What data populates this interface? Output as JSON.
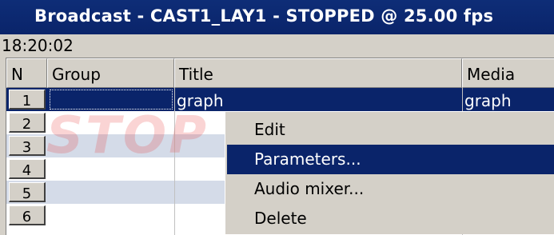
{
  "window": {
    "title": "Broadcast - CAST1_LAY1 - STOPPED @ 25.00 fps",
    "clock": "18:20:02"
  },
  "colors": {
    "titlebar": "#0a246a",
    "selection": "#0a246a",
    "alt_row": "#d4dbe8",
    "watermark": "#e83c3c"
  },
  "grid": {
    "columns": [
      "N",
      "Group",
      "Title",
      "Media"
    ],
    "rows": [
      {
        "n": "1",
        "group": "",
        "title": "graph",
        "media": "graph",
        "selected": true
      },
      {
        "n": "2",
        "group": "",
        "title": "",
        "media": "",
        "selected": false
      },
      {
        "n": "3",
        "group": "",
        "title": "",
        "media": "",
        "selected": false
      },
      {
        "n": "4",
        "group": "",
        "title": "",
        "media": "",
        "selected": false
      },
      {
        "n": "5",
        "group": "",
        "title": "",
        "media": "",
        "selected": false
      },
      {
        "n": "6",
        "group": "",
        "title": "",
        "media": "",
        "selected": false
      }
    ],
    "watermark": "STOP"
  },
  "context_menu": {
    "items": [
      "Edit",
      "Parameters...",
      "Audio mixer...",
      "Delete"
    ],
    "highlighted": "Parameters..."
  }
}
